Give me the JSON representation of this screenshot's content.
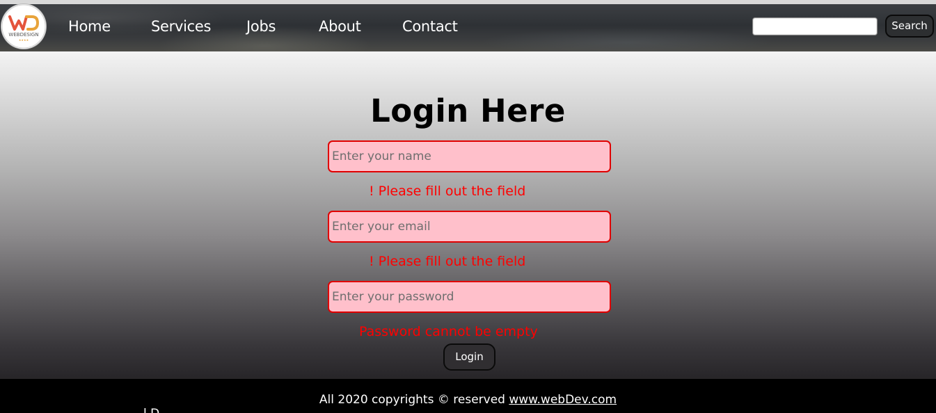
{
  "logo": {
    "brand_text": "WEBDESIGN",
    "mark": "WD"
  },
  "nav": {
    "links": [
      "Home",
      "Services",
      "Jobs",
      "About",
      "Contact"
    ],
    "search": {
      "value": "",
      "button_label": "Search"
    }
  },
  "login": {
    "title": "Login Here",
    "fields": [
      {
        "placeholder": "Enter your name",
        "error": "! Please fill out the field"
      },
      {
        "placeholder": "Enter your email",
        "error": "! Please fill out the field"
      },
      {
        "placeholder": "Enter your password",
        "error": "Password cannot be empty"
      }
    ],
    "button_label": "Login"
  },
  "footer": {
    "text": "All 2020 copyrights © reserved ",
    "link_text": "www.webDev.com",
    "fragment": "l D"
  },
  "colors": {
    "error": "#ff0000",
    "field_bg": "#ffc0cb",
    "field_border": "#e00000",
    "nav_bg": "#33363a",
    "footer_bg": "#000000"
  }
}
